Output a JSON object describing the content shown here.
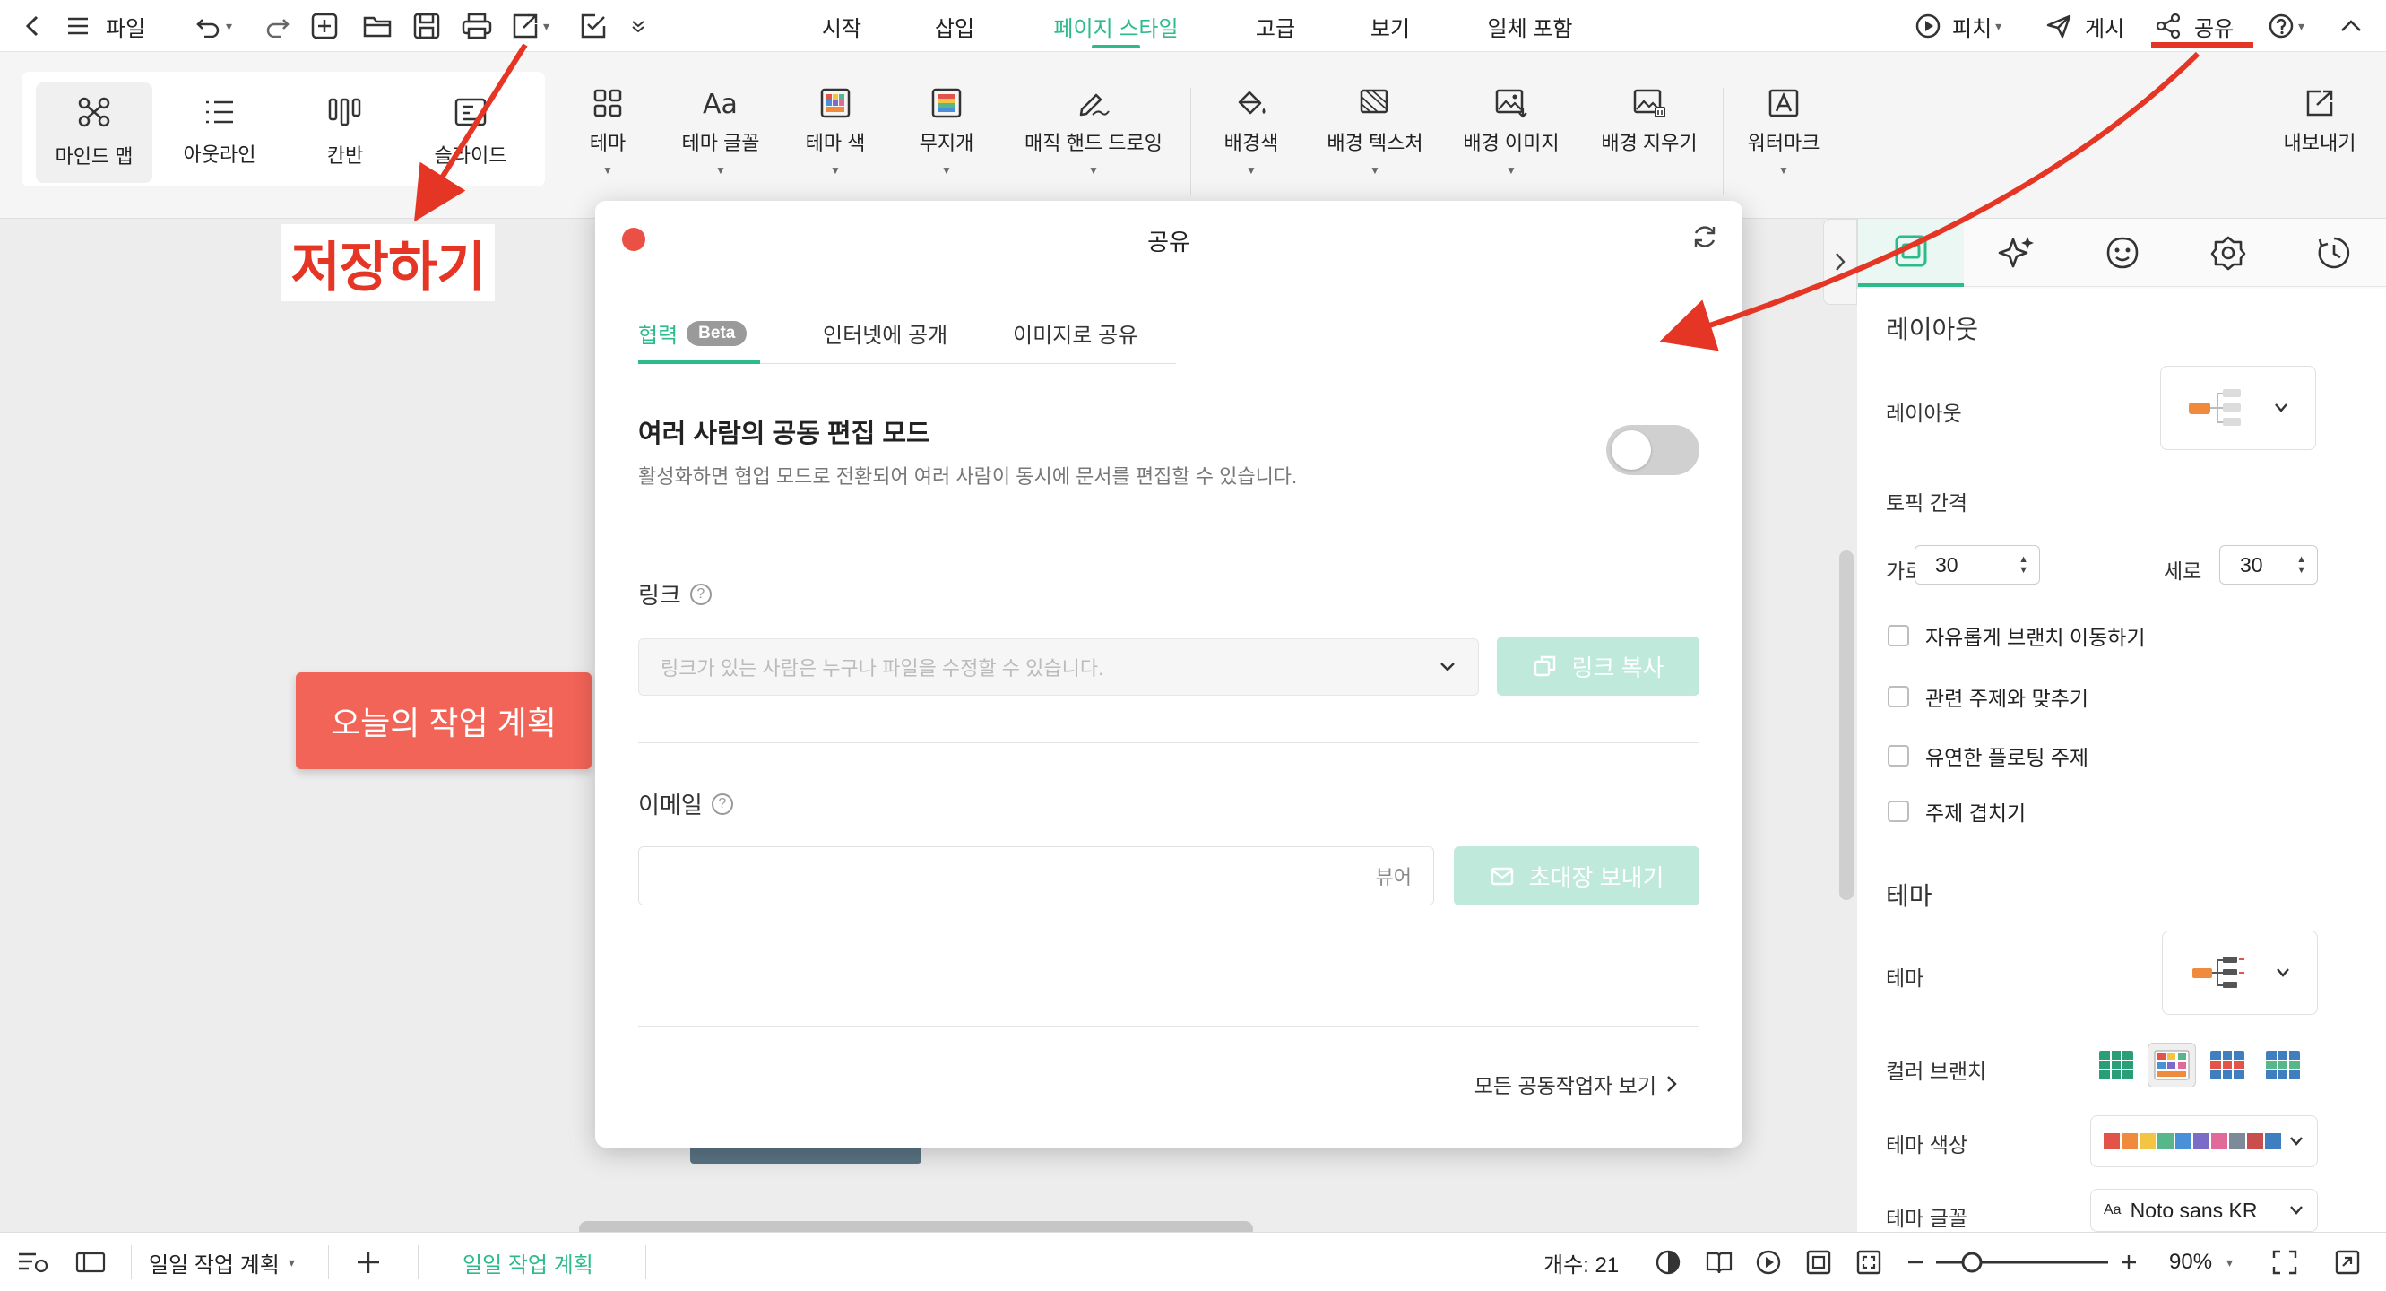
{
  "topbar": {
    "file_label": "파일",
    "menu_tabs": [
      "시작",
      "삽입",
      "페이지 스타일",
      "고급",
      "보기",
      "일체 포함"
    ],
    "active_tab": "페이지 스타일",
    "pitch_label": "피치",
    "publish_label": "게시",
    "share_label": "공유"
  },
  "ribbon": {
    "views": [
      "마인드 맵",
      "아웃라인",
      "칸반",
      "슬라이드"
    ],
    "tools": [
      "테마",
      "테마 글꼴",
      "테마 색",
      "무지개",
      "매직 핸드 드로잉",
      "배경색",
      "배경 텍스처",
      "배경 이미지",
      "배경 지우기",
      "워터마크"
    ],
    "export_label": "내보내기"
  },
  "annotation": {
    "text": "저장하기",
    "color": "#e53524"
  },
  "canvas": {
    "central_topic": "오늘의 작업 계획",
    "topic_color": "#f26457"
  },
  "dialog": {
    "title": "공유",
    "tabs": [
      "협력",
      "인터넷에 공개",
      "이미지로 공유"
    ],
    "beta_badge": "Beta",
    "collab_title": "여러 사람의 공동 편집 모드",
    "collab_desc": "활성화하면 협업 모드로 전환되어 여러 사람이 동시에 문서를 편집할 수 있습니다.",
    "collab_enabled": false,
    "link_label": "링크",
    "link_option": "링크가 있는 사람은 누구나 파일을 수정할 수 있습니다.",
    "copy_link_label": "링크 복사",
    "email_label": "이메일",
    "email_role": "뷰어",
    "send_invite_label": "초대장 보내기",
    "see_all_label": "모든 공동작업자 보기"
  },
  "right_panel": {
    "layout_head": "레이아웃",
    "layout_label": "레이아웃",
    "topic_spacing_label": "토픽 간격",
    "horizontal_label": "가로",
    "horizontal_value": "30",
    "vertical_label": "세로",
    "vertical_value": "30",
    "checkboxes": [
      "자유롭게 브랜치 이동하기",
      "관련 주제와 맞추기",
      "유연한 플로팅 주제",
      "주제 겹치기"
    ],
    "theme_head": "테마",
    "theme_label": "테마",
    "color_branch_label": "컬러 브랜치",
    "theme_color_label": "테마 색상",
    "theme_font_label": "테마 글꼴",
    "theme_font_value": "Noto sans KR",
    "theme_font_prefix": "Aa",
    "palette": [
      "#e2534a",
      "#f08a3c",
      "#f4c542",
      "#58b78a",
      "#4a90d9",
      "#7b6cc7",
      "#e26a9a",
      "#7c8a99",
      "#c94f4f",
      "#3f7fbf"
    ]
  },
  "statusbar": {
    "doc_tab": "일일 작업 계획",
    "doc_title": "일일 작업 계획",
    "count_label": "개수: 21",
    "zoom": "90%"
  }
}
